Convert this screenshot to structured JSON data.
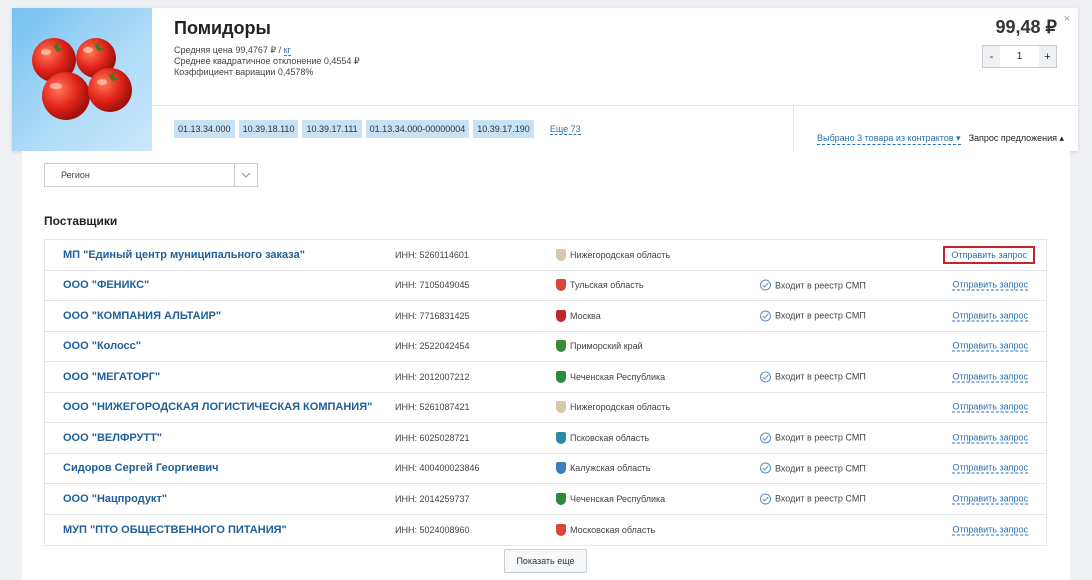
{
  "product": {
    "title": "Помидоры",
    "avg_price": "Средняя цена 99,4767 ₽ /",
    "unit_link": "кг",
    "std_dev": "Среднее квадратичное отклонение 0,4554 ₽",
    "variation": "Коэффициент вариации 0,4578%",
    "price": "99,48 ₽",
    "quantity": "1",
    "codes": [
      "01.13.34.000",
      "10.39.18.110",
      "10.39.17.111",
      "01.13.34.000-00000004",
      "10.39.17.190"
    ],
    "more_codes": "Еще 73",
    "selected_contracts": "Выбрано 3 товара из контрактов ▾",
    "request_offer": "Запрос предложения ▴",
    "close_symbol": "×",
    "minus": "-",
    "plus": "+"
  },
  "filter": {
    "region_label": "Регион"
  },
  "suppliers_title": "Поставщики",
  "suppliers": [
    {
      "name": "МП \"Единый центр муниципального заказа\"",
      "inn": "ИНН: 5260114601",
      "region": "Нижегородская область",
      "crest_color": "#d8c9a8",
      "smp": "",
      "action": "Отправить запрос"
    },
    {
      "name": "ООО \"ФЕНИКС\"",
      "inn": "ИНН: 7105049045",
      "region": "Тульская область",
      "crest_color": "#d9473b",
      "smp": "Входит в реестр СМП",
      "action": "Отправить запрос"
    },
    {
      "name": "ООО \"КОМПАНИЯ АЛЬТАИР\"",
      "inn": "ИНН: 7716831425",
      "region": "Москва",
      "crest_color": "#c0262c",
      "smp": "Входит в реестр СМП",
      "action": "Отправить запрос"
    },
    {
      "name": "ООО \"Колосс\"",
      "inn": "ИНН: 2522042454",
      "region": "Приморский край",
      "crest_color": "#3a8a3a",
      "smp": "",
      "action": "Отправить запрос"
    },
    {
      "name": "ООО \"МЕГАТОРГ\"",
      "inn": "ИНН: 2012007212",
      "region": "Чеченская Республика",
      "crest_color": "#2e8b3e",
      "smp": "Входит в реестр СМП",
      "action": "Отправить запрос"
    },
    {
      "name": "ООО \"НИЖЕГОРОДСКАЯ ЛОГИСТИЧЕСКАЯ КОМПАНИЯ\"",
      "inn": "ИНН: 5261087421",
      "region": "Нижегородская область",
      "crest_color": "#d8c9a8",
      "smp": "",
      "action": "Отправить запрос"
    },
    {
      "name": "ООО \"ВЕЛФРУТТ\"",
      "inn": "ИНН: 6025028721",
      "region": "Псковская область",
      "crest_color": "#2a8aa8",
      "smp": "Входит в реестр СМП",
      "action": "Отправить запрос"
    },
    {
      "name": "Сидоров Сергей Георгиевич",
      "inn": "ИНН: 400400023846",
      "region": "Калужская область",
      "crest_color": "#3b7fc0",
      "smp": "Входит в реестр СМП",
      "action": "Отправить запрос"
    },
    {
      "name": "ООО \"Нацпродукт\"",
      "inn": "ИНН: 2014259737",
      "region": "Чеченская Республика",
      "crest_color": "#2e8b3e",
      "smp": "Входит в реестр СМП",
      "action": "Отправить запрос"
    },
    {
      "name": "МУП \"ПТО ОБЩЕСТВЕННОГО ПИТАНИЯ\"",
      "inn": "ИНН: 5024008960",
      "region": "Московская область",
      "crest_color": "#d9473b",
      "smp": "",
      "action": "Отправить запрос"
    }
  ],
  "show_more": "Показать еще",
  "highlighted_index": 0
}
